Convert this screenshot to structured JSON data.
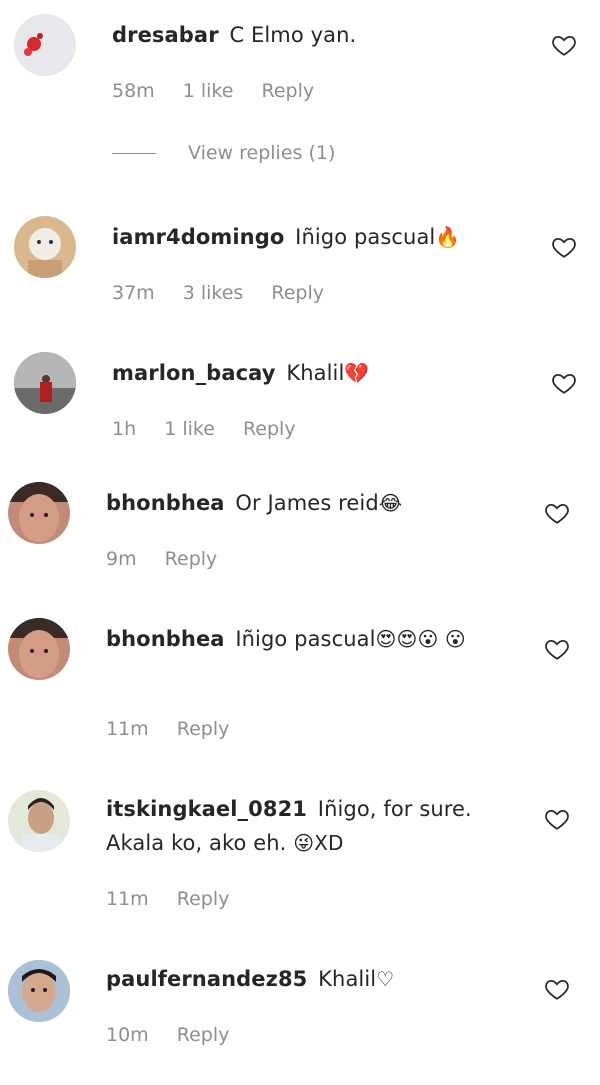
{
  "comments": [
    {
      "username": "dresabar",
      "text": "C Elmo yan.",
      "emoji": "",
      "time": "58m",
      "likes": "1 like",
      "reply": "Reply",
      "view_replies": "View replies (1)"
    },
    {
      "username": "iamr4domingo",
      "text": "Iñigo pascual",
      "emoji": "🔥",
      "time": "37m",
      "likes": "3 likes",
      "reply": "Reply"
    },
    {
      "username": "marlon_bacay",
      "text": "Khalil",
      "emoji": "💔",
      "time": "1h",
      "likes": "1 like",
      "reply": "Reply"
    },
    {
      "username": "bhonbhea",
      "text": "Or James reid",
      "emoji": "😂",
      "time": "9m",
      "likes": "",
      "reply": "Reply"
    },
    {
      "username": "bhonbhea",
      "text": "Iñigo pascual",
      "emoji": "😍😍😮 😮",
      "time": "11m",
      "likes": "",
      "reply": "Reply"
    },
    {
      "username": "itskingkael_0821",
      "text": "Iñigo, for sure. Akala ko, ako eh.",
      "emoji": "😜XD",
      "time": "11m",
      "likes": "",
      "reply": "Reply"
    },
    {
      "username": "paulfernandez85",
      "text": "Khalil",
      "emoji": "♡",
      "time": "10m",
      "likes": "",
      "reply": "Reply"
    }
  ]
}
